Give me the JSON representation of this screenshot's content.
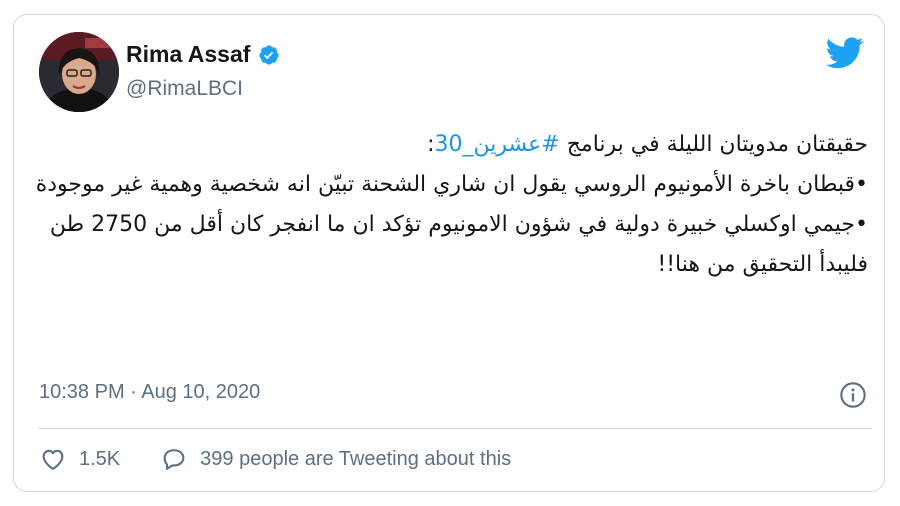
{
  "author": {
    "name": "Rima Assaf",
    "handle": "@RimaLBCI",
    "verified": true
  },
  "icons": {
    "brand": "twitter-bird-icon",
    "verified": "verified-badge-icon",
    "info": "info-icon",
    "like": "heart-icon",
    "reply": "speech-bubble-icon"
  },
  "colors": {
    "brand": "#1da1f2",
    "link": "#1b95e0",
    "secondary_text": "#5b7083",
    "border": "#cfd9de"
  },
  "tweet": {
    "line1_prefix": "حقيقتان مدويتان الليلة في برنامج ",
    "hashtag": "#عشرين_30",
    "line1_suffix": ":",
    "line2": "•قبطان باخرة الأمونيوم الروسي يقول ان شاري الشحنة تبيّن انه شخصية وهمية غير موجودة",
    "line3": "•جيمي اوكسلي خبيرة دولية في شؤون الامونيوم تؤكد ان ما انفجر كان أقل من 2750 طن",
    "line4": "فليبدأ التحقيق من هنا!!"
  },
  "timestamp": "10:38 PM · Aug 10, 2020",
  "actions": {
    "likes": "1.5K",
    "conversation": "399 people are Tweeting about this"
  }
}
